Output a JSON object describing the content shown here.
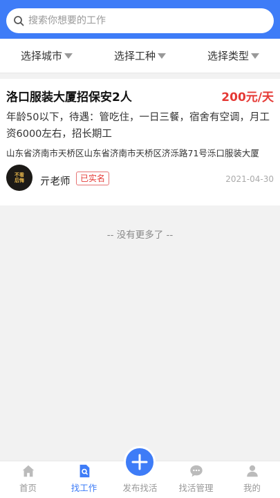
{
  "search": {
    "placeholder": "搜索你想要的工作"
  },
  "filters": [
    {
      "label": "选择城市"
    },
    {
      "label": "选择工种"
    },
    {
      "label": "选择类型"
    }
  ],
  "job": {
    "title": "洛口服装大厦招保安2人",
    "salary": "200元/天",
    "description": "年龄50以下，待遇：管吃住，一日三餐，宿舍有空调，月工资6000左右，招长期工",
    "address": "山东省济南市天桥区山东省济南市天桥区济泺路71号泺口服装大厦",
    "poster": "亓老师",
    "badge": "已实名",
    "date": "2021-04-30",
    "avatar_text": [
      "不看",
      "后悔"
    ]
  },
  "no_more": "-- 没有更多了 --",
  "tabbar": [
    {
      "label": "首页",
      "icon": "home-icon"
    },
    {
      "label": "找工作",
      "icon": "find-job-icon",
      "active": true
    },
    {
      "label": "发布找活",
      "icon": "plus-icon"
    },
    {
      "label": "找活管理",
      "icon": "chat-icon"
    },
    {
      "label": "我的",
      "icon": "user-icon"
    }
  ],
  "colors": {
    "brand": "#3e7cf7",
    "salary": "#e53935",
    "inactive": "#999999"
  }
}
